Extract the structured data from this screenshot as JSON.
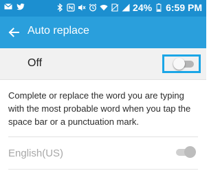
{
  "status_bar": {
    "battery": "24%",
    "time": "6:59 PM",
    "icons": [
      "mail-icon",
      "twitter-icon",
      "bluetooth-icon",
      "nfc-icon",
      "mute-icon",
      "alarm-icon",
      "wifi-icon",
      "no-sim-icon",
      "signal-icon",
      "battery-icon"
    ],
    "background": "#1c8fd0"
  },
  "app_bar": {
    "title": "Auto replace",
    "background": "#2a9fdc"
  },
  "master_switch": {
    "label": "Off",
    "state": "off",
    "highlight_color": "#1ba6e6"
  },
  "description": "Complete or replace the word you are typing with the most probable word when you tap the space bar or a punctuation mark.",
  "languages": [
    {
      "label": "English(US)",
      "enabled": true,
      "disabled_appearance": true
    }
  ]
}
